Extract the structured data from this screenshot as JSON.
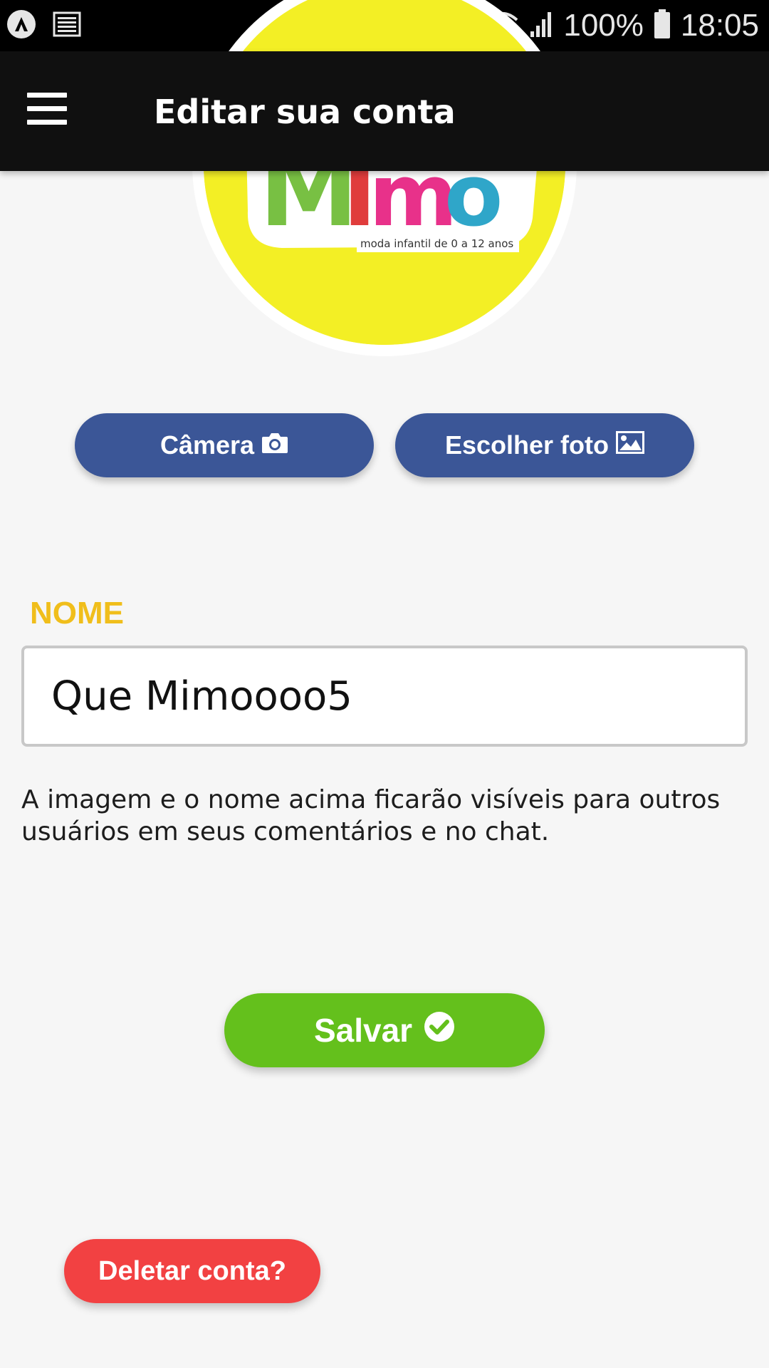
{
  "status_bar": {
    "battery": "100%",
    "time": "18:05"
  },
  "app_bar": {
    "title": "Editar sua conta"
  },
  "avatar": {
    "logo_text": "Mimo",
    "logo_tagline": "moda infantil de 0 a 12 anos"
  },
  "photo_buttons": {
    "camera_label": "Câmera",
    "gallery_label": "Escolher foto"
  },
  "form": {
    "name_label": "NOME",
    "name_value": "Que Mimoooo5",
    "info_text": "A imagem e o nome acima ficarão visíveis para outros usuários em seus comentários e no chat."
  },
  "actions": {
    "save_label": "Salvar",
    "delete_label": "Deletar conta?"
  },
  "colors": {
    "app_bar": "#101010",
    "photo_button": "#3b5697",
    "label_accent": "#f0be1b",
    "save_button": "#64c01c",
    "delete_button": "#f24142",
    "avatar_bg": "#f3ef25"
  }
}
